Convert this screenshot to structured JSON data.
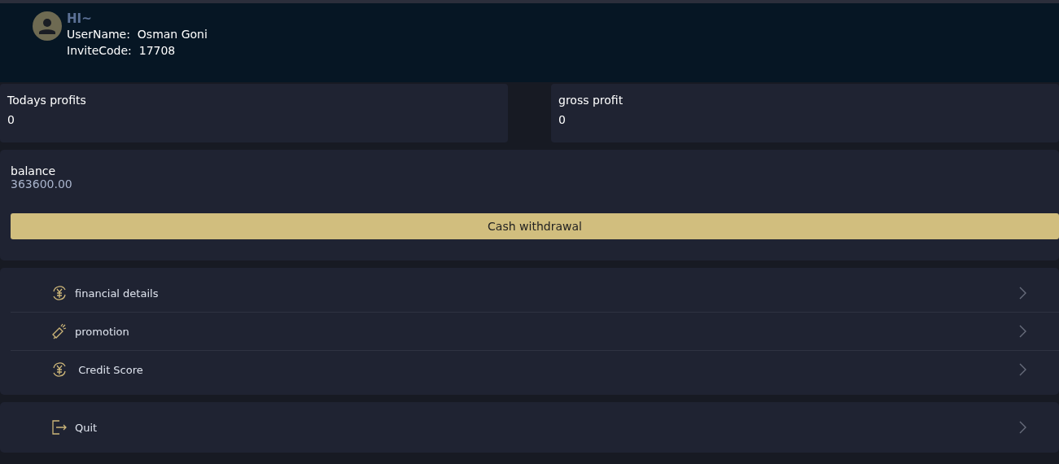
{
  "header": {
    "greeting": "HI~",
    "username_label": "UserName:",
    "username": "Osman Goni",
    "invite_label": "InviteCode:",
    "invite_code": "17708"
  },
  "stats": [
    {
      "label": "Todays profits",
      "value": "0"
    },
    {
      "label": "gross profit",
      "value": "0"
    }
  ],
  "balance": {
    "label": "balance",
    "value": "363600.00",
    "button": "Cash withdrawal"
  },
  "menu": [
    {
      "kind": "yen",
      "label": "financial details"
    },
    {
      "kind": "megaphone",
      "label": "promotion"
    },
    {
      "kind": "yen",
      "label": " Credit Score"
    }
  ],
  "quit": {
    "kind": "exit",
    "label": "Quit"
  }
}
